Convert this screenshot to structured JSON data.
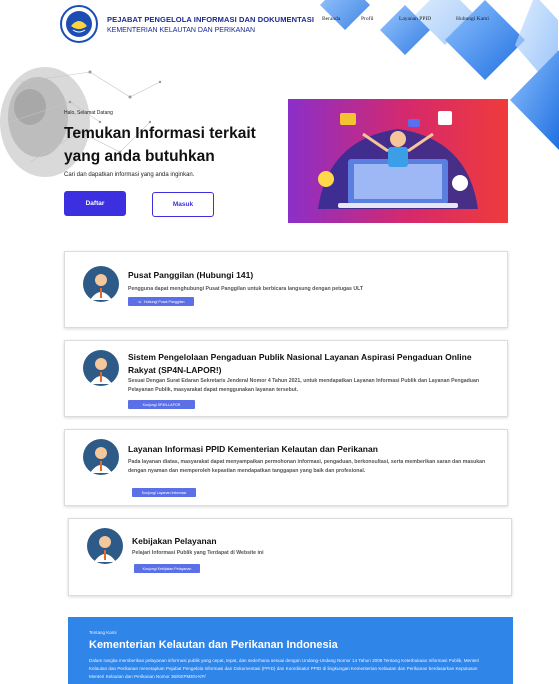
{
  "header": {
    "title": "PEJABAT PENGELOLA INFORMASI DAN DOKUMENTASI",
    "subtitle": "KEMENTERIAN KELAUTAN DAN PERIKANAN",
    "nav": [
      "Beranda",
      "Profil",
      "Layanan PPID",
      "Hubungi Kami"
    ]
  },
  "hero": {
    "greeting": "Halo, Selamat Datang",
    "title": "Temukan Informasi terkait yang anda butuhkan",
    "description": "Cari dan dapatkan informasi yang anda inginkan.",
    "register_label": "Daftar",
    "login_label": "Masuk"
  },
  "services": [
    {
      "title": "Pusat Panggilan (Hubungi 141)",
      "description": "Pengguna dapat menghubungi Pusat Panggilan untuk berbicara langsung dengan petugas ULT",
      "button": "Hubungi Pusat Panggilan"
    },
    {
      "title": "Sistem Pengelolaan Pengaduan Publik Nasional Layanan Aspirasi Pengaduan Online Rakyat (SP4N-LAPOR!)",
      "description": "Sesuai Dengan Surat Edaran Sekretaris Jenderal Nomor 4 Tahun 2021, untuk mendapatkan Layanan Informasi Publik dan Layanan Pengaduan Pelayanan Publik, masyarakat dapat menggunakan layanan tersebut.",
      "button": "Kunjungi SP4N-LAPOR"
    },
    {
      "title": "Layanan Informasi PPID Kementerian Kelautan dan Perikanan",
      "description": "Pada layanan diatas, masyarakat dapat menyampaikan permohonan informasi, pengaduan, berkonsultasi, serta memberikan saran dan masukan dengan nyaman dan memperoleh kepastian mendapatkan tanggapan yang baik dan profesional.",
      "button": "Kunjungi Layanan Informasi"
    },
    {
      "title": "Kebijakan Pelayanan",
      "description": "Pelajari Informasi Publik yang Terdapat di Website ini",
      "button": "Kunjungi Kebijakan Pelayanan"
    }
  ],
  "about": {
    "label": "Tentang Kami",
    "title": "Kementerian Kelautan dan Perikanan Indonesia",
    "text": "Dalam rangka memberikan pelayanan informasi publik yang cepat, tepat, dan sederhana sesuai dengan Undang-Undang Nomor 14 Tahun 2008 Tentang Keterbukaan Informasi Publik, Menteri Kelautan dan Perikanan menetapkan Pejabat Pengelola Informasi dan Dokumentasi (PPID) dan Koordinator PPID di lingkungan Kementerian Kelautan dan Perikanan berdasarkan Keputusan Menteri Kelautan dan Perikanan Nomor 36/KEPMEN-KP/"
  },
  "colors": {
    "primary": "#3b2fe0",
    "brand_navy": "#1b2a8f",
    "accent_blue": "#2f86e8",
    "card_button": "#5b6fe6"
  },
  "icons": [
    "logo-emblem",
    "world-map-graphic",
    "hero-illustration",
    "phone-icon",
    "avatar-icon"
  ]
}
